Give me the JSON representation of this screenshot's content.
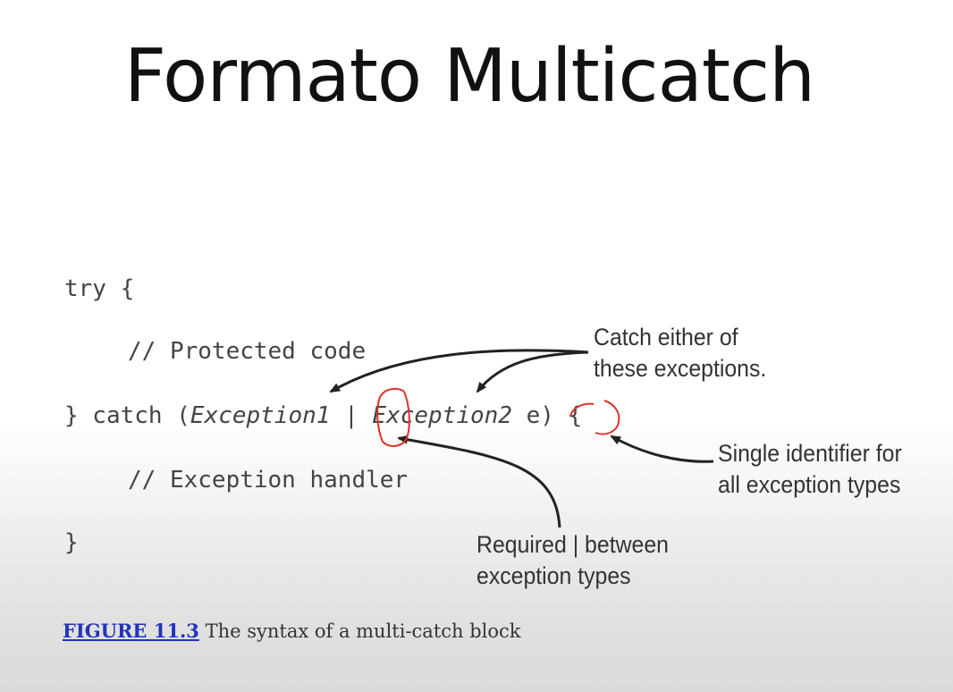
{
  "slide": {
    "title": "Formato Multicatch"
  },
  "code": {
    "line1": "try {",
    "line2": "// Protected code",
    "line3_start": "} catch (",
    "line3_ex1": "Exception1",
    "line3_pipe": " | ",
    "line3_ex2": "Exception2",
    "line3_end": " e) {",
    "line4": "// Exception handler",
    "line5": "}"
  },
  "callouts": {
    "catch_either_1": "Catch either of",
    "catch_either_2": "these exceptions.",
    "single_id_1": "Single identifier for",
    "single_id_2": "all exception types",
    "required_1": "Required | between",
    "required_2": "exception types"
  },
  "caption": {
    "link": "FIGURE 11.3",
    "text": " The syntax of a multi-catch block"
  },
  "colors": {
    "annotation_red": "#e0302a",
    "link_blue": "#2233bb"
  }
}
